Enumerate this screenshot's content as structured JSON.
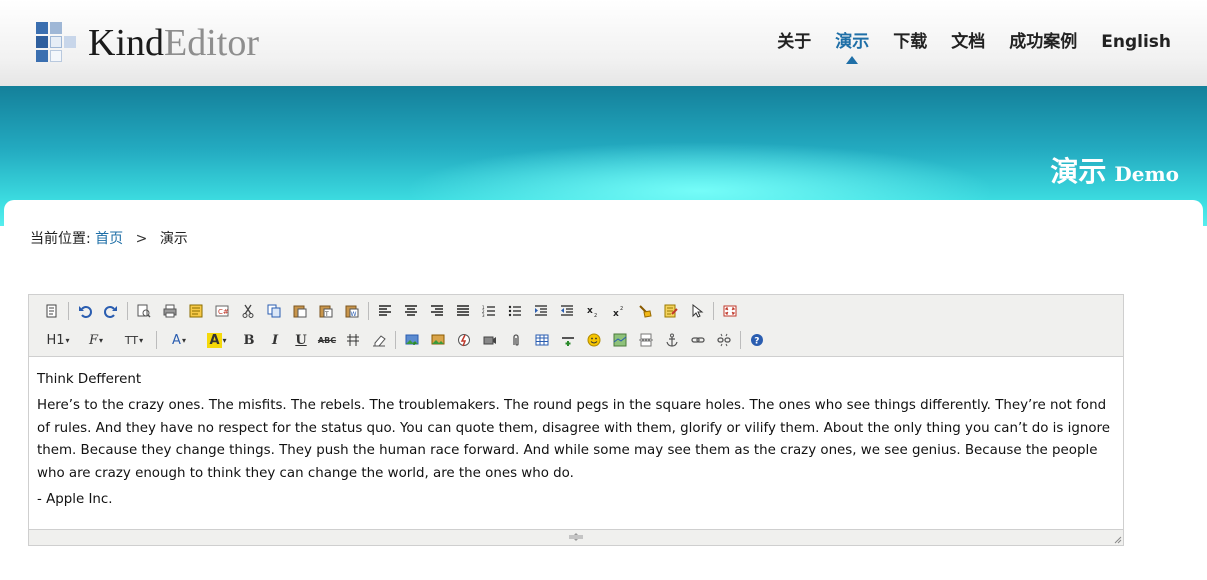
{
  "logo": {
    "bold": "Kind",
    "light": "Editor"
  },
  "nav": {
    "items": [
      {
        "label": "关于"
      },
      {
        "label": "演示"
      },
      {
        "label": "下载"
      },
      {
        "label": "文档"
      },
      {
        "label": "成功案例"
      },
      {
        "label": "English"
      }
    ],
    "active_index": 1
  },
  "banner": {
    "title_cn": "演示",
    "title_en": "Demo"
  },
  "breadcrumb": {
    "prefix": "当前位置:",
    "home": "首页",
    "separator": ">",
    "current": "演示"
  },
  "editor": {
    "toolbar_row1": [
      "source",
      "undo",
      "redo",
      "preview",
      "print",
      "template",
      "code",
      "cut",
      "copy",
      "paste",
      "plainpaste",
      "wordpaste",
      "justifyleft",
      "justifycenter",
      "justifyright",
      "justifyfull",
      "insertorderedlist",
      "insertunorderedlist",
      "indent",
      "outdent",
      "subscript",
      "superscript",
      "clearhtml",
      "quickformat",
      "selectall",
      "fullscreen"
    ],
    "toolbar_row2_labels": {
      "formatblock": "H1",
      "fontname": "F",
      "fontsize": "TT",
      "forecolor": "A",
      "hilitecolor": "A",
      "bold": "B",
      "italic": "I",
      "underline": "U",
      "strikethrough": "ABC"
    },
    "content": {
      "heading": "Think Defferent",
      "paragraph": "Here’s to the crazy ones. The misfits. The rebels. The troublemakers. The round pegs in the square holes. The ones who see things differently. They’re not fond of rules. And they have no respect for the status quo. You can quote them, disagree with them, glorify or vilify them. About the only thing you can’t do is ignore them. Because they change things. They push the human race forward. And while some may see them as the crazy ones, we see genius. Because the people who are crazy enough to think they can change the world, are the ones who do.",
      "signature": "- Apple Inc."
    }
  },
  "colors": {
    "accent": "#1f6fa7",
    "banner_dark": "#14809a",
    "banner_light": "#57eeee",
    "toolbar_bg": "#f0f0ee"
  }
}
